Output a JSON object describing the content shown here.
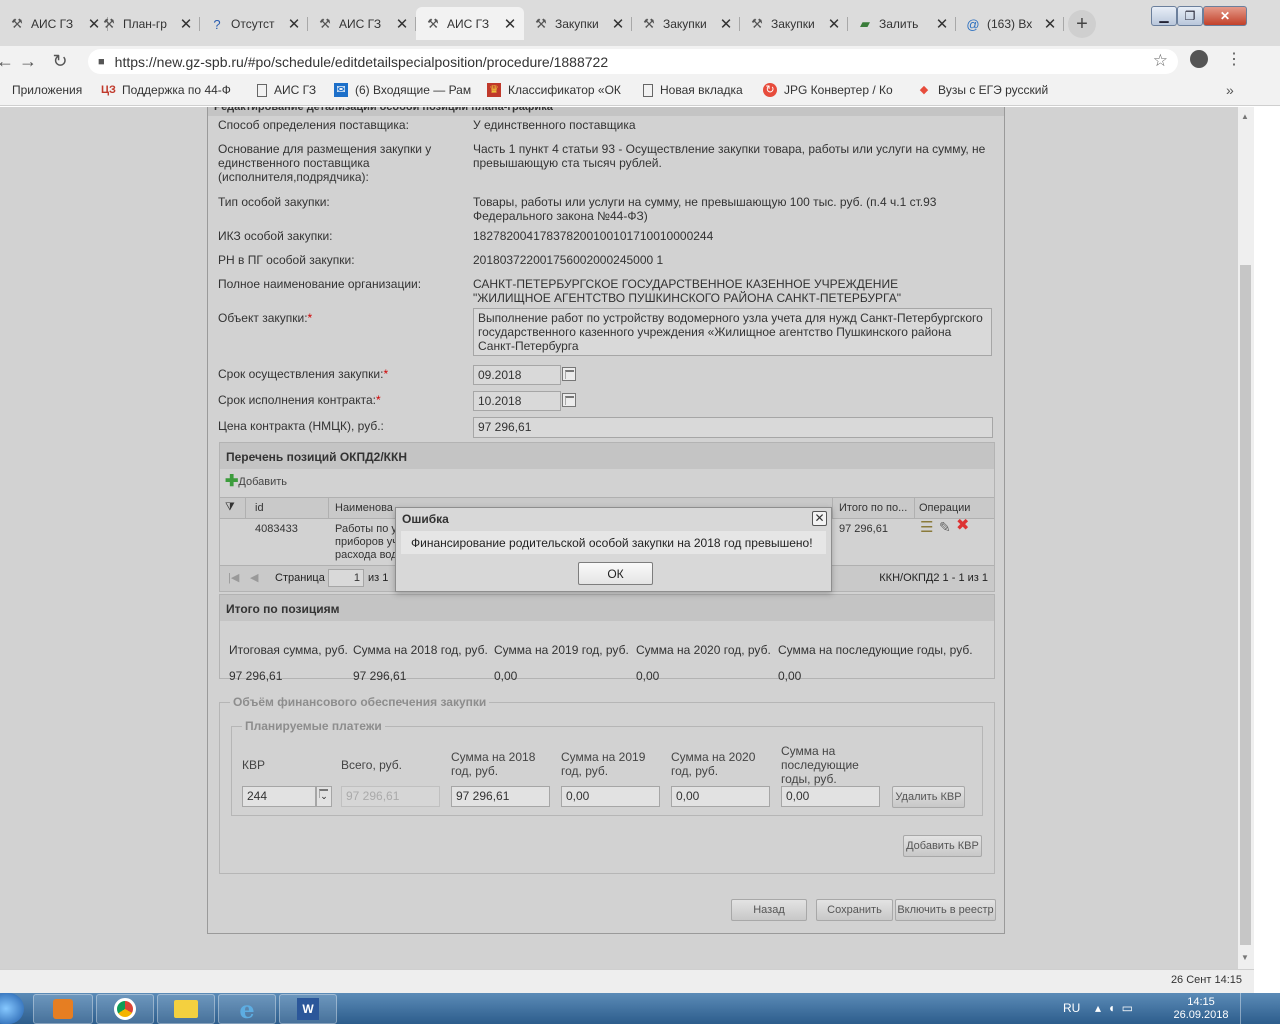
{
  "browser": {
    "tabs": [
      {
        "title": "АИС ГЗ",
        "icon": "hammer"
      },
      {
        "title": "План-гр",
        "icon": "hammer"
      },
      {
        "title": "Отсутст",
        "icon": "help"
      },
      {
        "title": "АИС ГЗ",
        "icon": "hammer"
      },
      {
        "title": "АИС ГЗ",
        "icon": "hammer"
      },
      {
        "title": "Закупки",
        "icon": "hammer"
      },
      {
        "title": "Закупки",
        "icon": "hammer"
      },
      {
        "title": "Закупки",
        "icon": "hammer"
      },
      {
        "title": "Залить",
        "icon": "image"
      },
      {
        "title": "(163) Вх",
        "icon": "mail"
      }
    ],
    "active_tab_index": 4,
    "url": "https://new.gz-spb.ru/#po/schedule/editdetailspecialposition/procedure/1888722",
    "bookmarks": [
      {
        "label": "Приложения",
        "icon": "apps"
      },
      {
        "label": "Поддержка по 44-Ф",
        "icon": "logo"
      },
      {
        "label": "АИС ГЗ",
        "icon": "page"
      },
      {
        "label": "(6) Входящие — Рам",
        "icon": "mail"
      },
      {
        "label": "Классификатор «ОК",
        "icon": "emblem"
      },
      {
        "label": "Новая вкладка",
        "icon": "page"
      },
      {
        "label": "JPG Конвертер / Ко",
        "icon": "convert"
      },
      {
        "label": "Вузы с ЕГЭ русский",
        "icon": "flag"
      }
    ]
  },
  "form": {
    "header": "Редактирование детализации особой позиции плана-графика",
    "fields": {
      "method": {
        "label": "Способ определения поставщика:",
        "value": "У единственного поставщика"
      },
      "basis": {
        "label": "Основание для размещения закупки у единственного поставщика (исполнителя,подрядчика):",
        "value": "Часть 1 пункт 4 статьи 93 - Осуществление закупки товара, работы или услуги на сумму, не превышающую ста тысяч рублей."
      },
      "special_type": {
        "label": "Тип особой закупки:",
        "value": "Товары, работы или услуги на сумму, не превышающую 100 тыс. руб. (п.4 ч.1 ст.93 Федерального закона №44-ФЗ)"
      },
      "ikz": {
        "label": "ИКЗ особой закупки:",
        "value": "182782004178378200100101710010000244"
      },
      "rn": {
        "label": "РН в ПГ особой закупки:",
        "value": "201803722001756002000245000 1"
      },
      "org_name": {
        "label": "Полное наименование организации:",
        "value": "САНКТ-ПЕТЕРБУРГСКОЕ ГОСУДАРСТВЕННОЕ КАЗЕННОЕ УЧРЕЖДЕНИЕ \"ЖИЛИЩНОЕ АГЕНТСТВО ПУШКИНСКОГО РАЙОНА САНКТ-ПЕТЕРБУРГА\""
      },
      "object": {
        "label": "Объект закупки:",
        "value": "Выполнение работ по устройству водомерного узла учета для нужд Санкт-Петербургского государственного казенного учреждения «Жилищное агентство Пушкинского района Санкт-Петербурга"
      },
      "purchase_period": {
        "label": "Срок осуществления закупки:",
        "value": "09.2018"
      },
      "contract_period": {
        "label": "Срок исполнения контракта:",
        "value": "10.2018"
      },
      "price": {
        "label": "Цена контракта (НМЦК), руб.:",
        "value": "97 296,61"
      }
    }
  },
  "okpd": {
    "title": "Перечень позиций ОКПД2/ККН",
    "add_label": "Добавить",
    "columns": [
      "id",
      "Наименова",
      "Итого по по...",
      "Операции"
    ],
    "rows": [
      {
        "id": "4083433",
        "name": "Работы по у приборов уч расхода вод",
        "total": "97 296,61"
      }
    ],
    "pager": {
      "page_label": "Страница",
      "page": "1",
      "of_label": "из 1",
      "summary": "ККН/ОКПД2 1 - 1 из 1"
    }
  },
  "totals": {
    "title": "Итого по позициям",
    "headers": [
      "Итоговая сумма, руб.",
      "Сумма на 2018 год, руб.",
      "Сумма на 2019 год, руб.",
      "Сумма на 2020 год, руб.",
      "Сумма на последующие годы, руб."
    ],
    "values": [
      "97 296,61",
      "97 296,61",
      "0,00",
      "0,00",
      "0,00"
    ]
  },
  "finance": {
    "title": "Объём финансового обеспечения закупки",
    "payments_title": "Планируемые платежи",
    "labels": {
      "kvr": "КВР",
      "total": "Всего, руб.",
      "y2018": "Сумма на 2018 год, руб.",
      "y2019": "Сумма на 2019 год, руб.",
      "y2020": "Сумма на 2020 год, руб.",
      "later": "Сумма на последующие годы, руб."
    },
    "row": {
      "kvr": "244",
      "total": "97 296,61",
      "y2018": "97 296,61",
      "y2019": "0,00",
      "y2020": "0,00",
      "later": "0,00"
    },
    "delete_kvr": "Удалить КВР",
    "add_kvr": "Добавить КВР"
  },
  "actions": {
    "back": "Назад",
    "save": "Сохранить",
    "include": "Включить в реестр"
  },
  "dialog": {
    "title": "Ошибка",
    "message": "Финансирование родительской особой закупки на 2018 год превышено!",
    "ok": "ОК"
  },
  "status": {
    "datetime": "26 Сент 14:15"
  },
  "taskbar": {
    "lang": "RU",
    "time": "14:15",
    "date": "26.09.2018"
  }
}
